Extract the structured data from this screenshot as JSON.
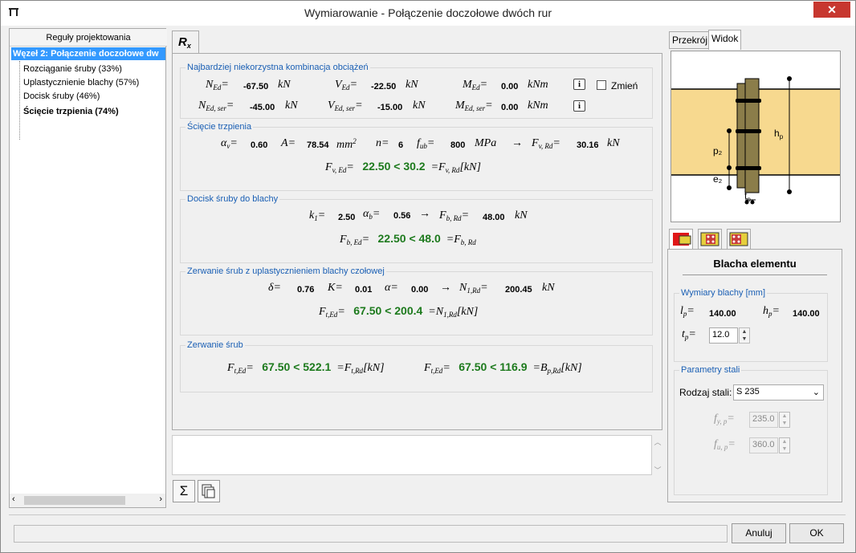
{
  "window": {
    "title": "Wymiarowanie - Połączenie doczołowe dwóch rur",
    "close_icon": "close-icon"
  },
  "tree": {
    "header": "Reguły projektowania",
    "selected": "Węzeł 2: Połączenie doczołowe dw",
    "items": [
      "Rozciąganie śruby (33%)",
      "Uplastycznienie blachy (57%)",
      "Docisk śruby (46%)",
      "Ścięcie trzpienia (74%)"
    ]
  },
  "center": {
    "tab": "R",
    "tab_sub": "x",
    "g1": {
      "title": "Najbardziej niekorzystna kombinacja obciążeń",
      "ned_sym": "N",
      "ned_sub": "Ed",
      "ned": "-67.50",
      "ned_u": "kN",
      "ved_sym": "V",
      "ved_sub": "Ed",
      "ved": "-22.50",
      "ved_u": "kN",
      "med_sym": "M",
      "med_sub": "Ed",
      "med": "0.00",
      "med_u": "kNm",
      "ns_sym": "N",
      "ns_sub": "Ed, ser",
      "ns": "-45.00",
      "ns_u": "kN",
      "vs_sym": "V",
      "vs_sub": "Ed, ser",
      "vs": "-15.00",
      "vs_u": "kN",
      "ms_sym": "M",
      "ms_sub": "Ed, ser",
      "ms": "0.00",
      "ms_u": "kNm",
      "change": "Zmień"
    },
    "g2": {
      "title": "Ścięcie trzpienia",
      "av_sym": "α",
      "av_sub": "v",
      "av": "0.60",
      "a_sym": "A",
      "a": "78.54",
      "a_u": "mm",
      "a_u_sup": "2",
      "n_sym": "n",
      "n": "6",
      "fub_sym": "f",
      "fub_sub": "ub",
      "fub": "800",
      "fub_u": "MPa",
      "fvrd_sym": "F",
      "fvrd_sub": "v, Rd",
      "fvrd": "30.16",
      "fvrd_u": "kN",
      "res_l_sym": "F",
      "res_l_sub": "v, Ed",
      "result": "22.50 < 30.2",
      "res_r_sym": "F",
      "res_r_sub": "v, Rd",
      "res_u": "[kN]"
    },
    "g3": {
      "title": "Docisk śruby do blachy",
      "k1_sym": "k",
      "k1_sub": "1",
      "k1": "2.50",
      "ab_sym": "α",
      "ab_sub": "b",
      "ab": "0.56",
      "fbrd_sym": "F",
      "fbrd_sub": "b, Rd",
      "fbrd": "48.00",
      "fbrd_u": "kN",
      "res_l_sym": "F",
      "res_l_sub": "b, Ed",
      "result": "22.50 < 48.0",
      "res_r_sym": "F",
      "res_r_sub": "b, Rd"
    },
    "g4": {
      "title": "Zerwanie śrub z uplastycznieniem blachy czołowej",
      "d_sym": "δ",
      "d": "0.76",
      "k_sym": "K",
      "k": "0.01",
      "al_sym": "α",
      "al": "0.00",
      "n1_sym": "N",
      "n1_sub": "1,Rd",
      "n1": "200.45",
      "n1_u": "kN",
      "res_l_sym": "F",
      "res_l_sub": "t,Ed",
      "result": "67.50 < 200.4",
      "res_r_sym": "N",
      "res_r_sub": "1,Rd",
      "res_u": "[kN]"
    },
    "g5": {
      "title": "Zerwanie śrub",
      "r1_l_sym": "F",
      "r1_l_sub": "t,Ed",
      "result1": "67.50 < 522.1",
      "r1_r_sym": "F",
      "r1_r_sub": "t,Rd",
      "r1_u": "[kN]",
      "r2_l_sym": "F",
      "r2_l_sub": "t,Ed",
      "result2": "67.50 < 116.9",
      "r2_r_sym": "B",
      "r2_r_sub": "p,Rd",
      "r2_u": "[kN]"
    },
    "toolbar": {
      "sum": "Σ"
    }
  },
  "right": {
    "tabs": [
      "Przekrój",
      "Widok"
    ],
    "view": {
      "hp": "h",
      "hp_sub": "p",
      "p2": "p₂",
      "e2": "e₂",
      "tp": "t",
      "tp_sub": "p"
    },
    "panel_title": "Blacha elementu",
    "dims": {
      "title": "Wymiary blachy [mm]",
      "lp_sym": "l",
      "lp_sub": "p",
      "lp": "140.00",
      "hp_sym": "h",
      "hp_sub": "p",
      "hp": "140.00",
      "tp_sym": "t",
      "tp_sub": "p",
      "tp": "12.0"
    },
    "steel": {
      "title": "Parametry stali",
      "kind_label": "Rodzaj stali:",
      "kind": "S 235",
      "fy_sym": "f",
      "fy_sub": "y, p",
      "fy": "235.0",
      "fu_sym": "f",
      "fu_sub": "u, p",
      "fu": "360.0"
    }
  },
  "footer": {
    "cancel": "Anuluj",
    "ok": "OK"
  },
  "colors": {
    "accent": "#3399ff",
    "green": "#1d7a1d",
    "group_title": "#1a5fb4",
    "pipe": "#f7d98f",
    "plate": "#8b7d4a"
  }
}
